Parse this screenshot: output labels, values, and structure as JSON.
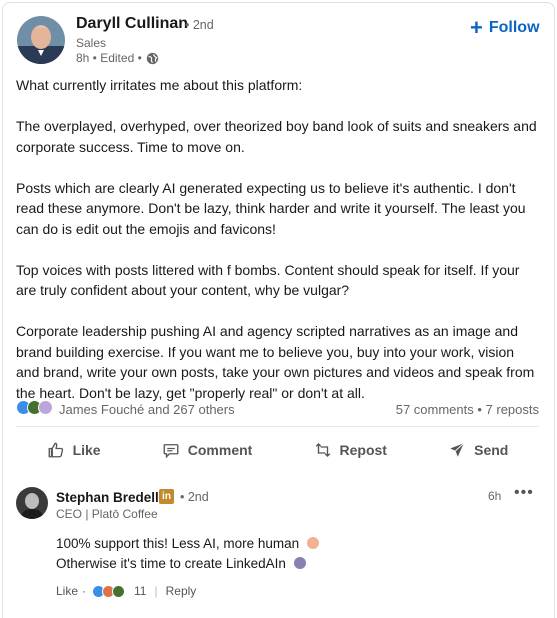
{
  "post": {
    "author": {
      "name": "Daryll Cullinan",
      "degree": "• 2nd",
      "headline": "Sales",
      "time": "8h • Edited •"
    },
    "follow_label": "Follow",
    "paragraphs": [
      "What currently irritates me about this platform:",
      "The overplayed, overhyped, over theorized boy band look of suits and sneakers and corporate success. Time to move on.",
      "Posts which are clearly AI generated expecting us to believe it's authentic. I don't read these anymore. Don't be lazy, think harder and write it yourself. The least you can do is edit out the emojis and favicons!",
      "Top voices with posts littered with f bombs. Content should speak for itself. If your are truly confident about your content, why be vulgar?",
      "Corporate leadership pushing AI and agency scripted narratives as an image and brand building exercise. If you want me to believe you, buy into your work, vision and brand, write your own posts, take your own pictures and videos and speak from the heart. Don't be lazy, get \"properly real\" or don't at all."
    ],
    "reaction_names": "James Fouché and 267 others",
    "counts": "57 comments • 7 reposts"
  },
  "actions": {
    "like": "Like",
    "comment": "Comment",
    "repost": "Repost",
    "send": "Send"
  },
  "comment": {
    "name": "Stephan Bredell",
    "badge": "in",
    "degree": "• 2nd",
    "headline": "CEO | Platō Coffee",
    "time": "6h",
    "more": "•••",
    "line1": "100% support this! Less AI, more human",
    "line2": "Otherwise it's time to create LinkedAIn",
    "like": "Like",
    "dot": "·",
    "reaction_count": "11",
    "separator": "|",
    "reply": "Reply"
  },
  "colors": {
    "accent": "#0a66c2",
    "like_reaction": "#378fe9",
    "celebrate_reaction": "#44712e",
    "support_reaction": "#bca6d9",
    "badge": "#c18a2d"
  }
}
